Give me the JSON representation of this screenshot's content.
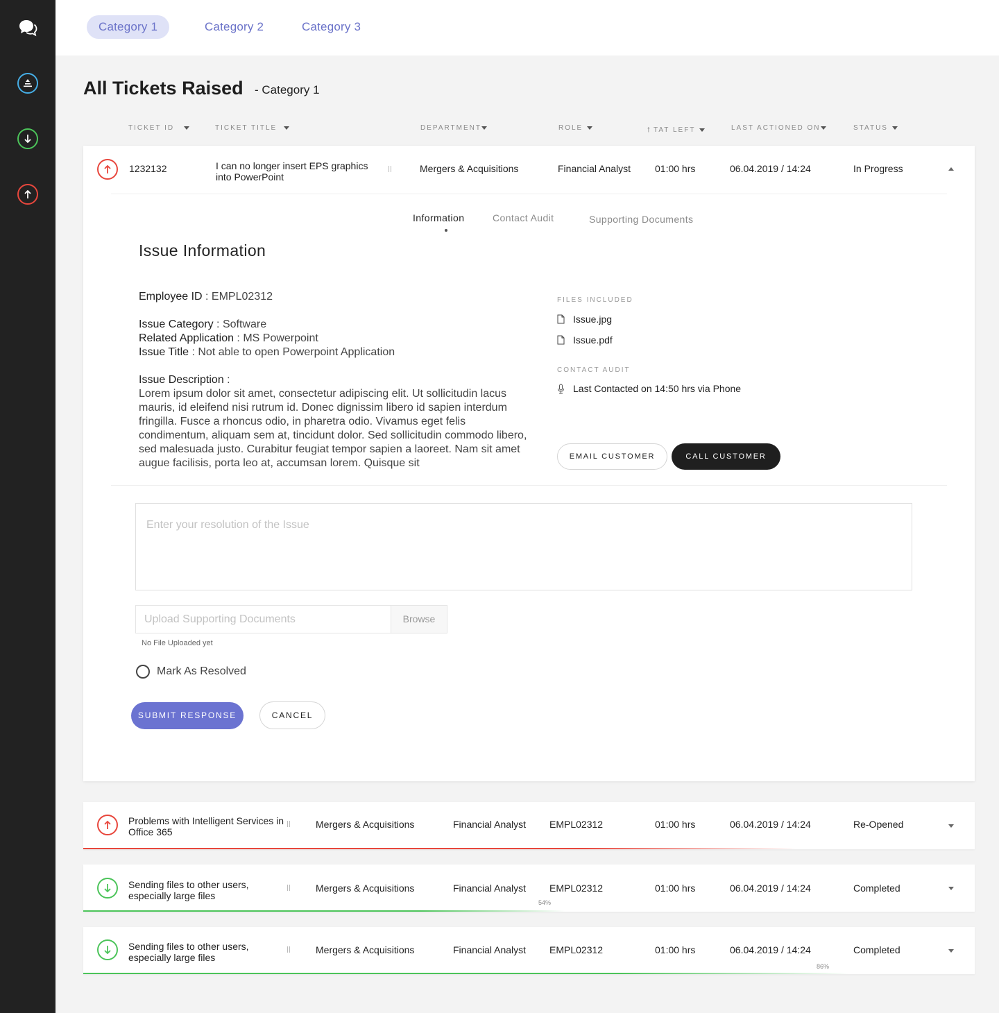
{
  "nav": {
    "tabs": [
      {
        "label": "Category 1",
        "active": true
      },
      {
        "label": "Category 2",
        "active": false
      },
      {
        "label": "Category 3",
        "active": false
      }
    ]
  },
  "page": {
    "title": "All Tickets Raised",
    "subtitle": "- Category 1"
  },
  "columns": {
    "ticket_id": "TICKET ID",
    "ticket_title": "TICKET TITLE",
    "department": "DEPARTMENT",
    "role": "ROLE",
    "tat_left": "TAT LEFT",
    "last_actioned": "LAST ACTIONED ON",
    "status": "STATUS"
  },
  "expanded_ticket": {
    "id": "1232132",
    "title_line1": "I can no longer insert EPS graphics",
    "title_line2": "into PowerPoint",
    "department": "Mergers & Acquisitions",
    "role": "Financial Analyst",
    "tat": "01:00 hrs",
    "last_actioned": "06.04.2019 / 14:24",
    "status": "In Progress",
    "tabs": [
      "Information",
      "Contact Audit",
      "Supporting Documents"
    ],
    "issue_heading": "Issue Information",
    "employee_id_label": "Employee ID",
    "employee_id": " : EMPL02312",
    "issue_category_label": "Issue Category",
    "issue_category": " : Software",
    "related_app_label": "Related Application",
    "related_app": " : MS Powerpoint",
    "issue_title_label": "Issue Title",
    "issue_title": " : Not able to open Powerpoint Application",
    "description_label": "Issue Description",
    "description_colon": " :",
    "description": "Lorem ipsum dolor sit amet, consectetur adipiscing elit. Ut sollicitudin lacus mauris, id eleifend nisi rutrum id. Donec dignissim libero id sapien interdum fringilla. Fusce a rhoncus odio, in pharetra odio. Vivamus eget felis condimentum, aliquam sem at, tincidunt dolor. Sed sollicitudin commodo libero, sed malesuada justo. Curabitur feugiat tempor sapien a laoreet. Nam sit amet augue facilisis, porta leo at, accumsan lorem. Quisque sit",
    "files_heading": "FILES INCLUDED",
    "files": [
      "Issue.jpg",
      "Issue.pdf"
    ],
    "contact_heading": "CONTACT AUDIT",
    "contact_text": "Last Contacted on 14:50 hrs via Phone",
    "email_btn": "EMAIL CUSTOMER",
    "call_btn": "CALL CUSTOMER",
    "resolution_placeholder": "Enter your resolution of the Issue",
    "upload_placeholder": "Upload Supporting Documents",
    "browse_label": "Browse",
    "no_file": "No File Uploaded yet",
    "mark_resolved": "Mark As Resolved",
    "submit_label": "SUBMIT RESPONSE",
    "cancel_label": "CANCEL"
  },
  "rows": [
    {
      "title_line1": "Problems with Intelligent Services in",
      "title_line2": "Office 365",
      "department": "Mergers & Acquisitions",
      "role": "Financial Analyst",
      "employee": "EMPL02312",
      "tat": "01:00 hrs",
      "last_actioned": "06.04.2019 / 14:24",
      "status": "Re-Opened",
      "direction": "up",
      "progress_pct": "",
      "progress_fraction": 0.8
    },
    {
      "title_line1": "Sending files to other users,",
      "title_line2": "especially large files",
      "department": "Mergers & Acquisitions",
      "role": "Financial Analyst",
      "employee": "EMPL02312",
      "tat": "01:00 hrs",
      "last_actioned": "06.04.2019 / 14:24",
      "status": "Completed",
      "direction": "down",
      "progress_pct": "54%",
      "progress_fraction": 0.54
    },
    {
      "title_line1": "Sending files to other users,",
      "title_line2": "especially large files",
      "department": "Mergers & Acquisitions",
      "role": "Financial Analyst",
      "employee": "EMPL02312",
      "tat": "01:00 hrs",
      "last_actioned": "06.04.2019 / 14:24",
      "status": "Completed",
      "direction": "down",
      "progress_pct": "86%",
      "progress_fraction": 0.86
    }
  ],
  "colors": {
    "accent": "#6b73d1",
    "up_red": "#e8473d",
    "down_green": "#4cc45a",
    "sidebar_blue": "#46aee6",
    "sidebar_bg": "#222222"
  }
}
